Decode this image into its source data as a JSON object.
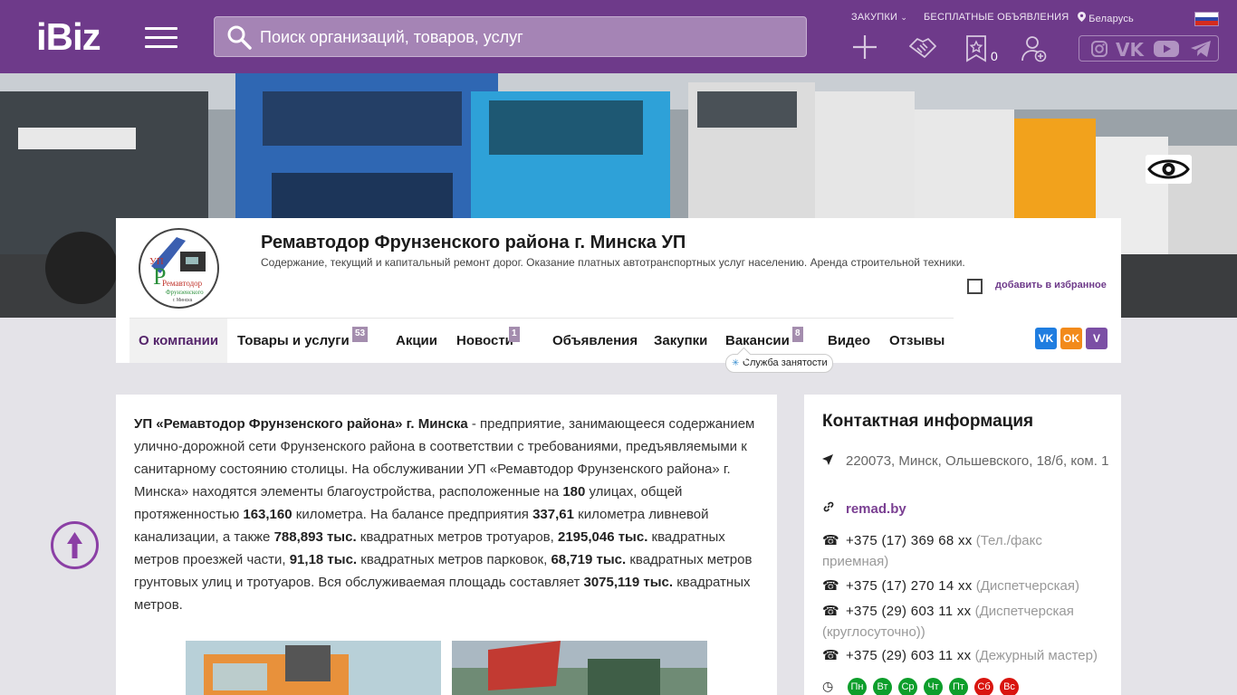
{
  "header": {
    "logo": "iBiz",
    "search_placeholder": "Поиск организаций, товаров, услуг",
    "links": {
      "purchases": "ЗАКУПКИ",
      "free_ads": "БЕСПЛАТНЫЕ ОБЪЯВЛЕНИЯ",
      "region": "Беларусь"
    },
    "favorites_count": "0",
    "icons": [
      "plus-icon",
      "handshake-icon",
      "star-bookmark-icon",
      "add-user-icon"
    ],
    "social": [
      "instagram-icon",
      "vk-icon",
      "youtube-icon",
      "telegram-icon"
    ]
  },
  "company": {
    "title": "Ремавтодор Фрунзенского района г. Минска УП",
    "description": "Содержание, текущий и капитальный ремонт дорог. Оказание платных автотранспортных услуг населению. Аренда строительной техники.",
    "logo_text": [
      "УП",
      "Р",
      "Ремавтодор",
      "Фрунзенского",
      "г. Минска"
    ],
    "favorite_label": "добавить в избранное"
  },
  "tabs": [
    {
      "label": "О компании"
    },
    {
      "label": "Товары и услуги",
      "badge": "53"
    },
    {
      "label": "Акции"
    },
    {
      "label": "Новости",
      "badge": "1"
    },
    {
      "label": "Объявления"
    },
    {
      "label": "Закупки"
    },
    {
      "label": "Вакансии",
      "badge": "8"
    },
    {
      "label": "Видео"
    },
    {
      "label": "Отзывы"
    }
  ],
  "tooltip": "Служба занятости",
  "share": {
    "vk": "VK",
    "ok": "OK",
    "viber": "V"
  },
  "about": {
    "parts": [
      [
        "b",
        "УП «Ремавтодор Фрунзенского района» г. Минска"
      ],
      [
        "t",
        " - предприятие, занимающееся содержанием улично-дорожной сети Фрунзенского района в соответствии с требованиями, предъявляемыми к санитарному состоянию столицы. На обслуживании УП «Ремавтодор Фрунзенского района» г. Минска» находятся элементы благоустройства, расположенные на "
      ],
      [
        "b",
        "180"
      ],
      [
        "t",
        " улицах, общей протяженностью "
      ],
      [
        "b",
        "163,160"
      ],
      [
        "t",
        " километра. На балансе предприятия "
      ],
      [
        "b",
        "337,61"
      ],
      [
        "t",
        " километра ливневой канализации, а также "
      ],
      [
        "b",
        "788,893 тыс."
      ],
      [
        "t",
        " квадратных метров тротуаров, "
      ],
      [
        "b",
        "2195,046 тыс."
      ],
      [
        "t",
        " квадратных метров проезжей части, "
      ],
      [
        "b",
        "91,18 тыс."
      ],
      [
        "t",
        " квадратных метров парковок, "
      ],
      [
        "b",
        "68,719 тыс."
      ],
      [
        "t",
        " квадратных метров грунтовых улиц и тротуаров. Вся обслуживаемая площадь составляет "
      ],
      [
        "b",
        "3075,119 тыс."
      ],
      [
        "t",
        " квадратных метров."
      ]
    ]
  },
  "contacts": {
    "title": "Контактная информация",
    "address": "220073, Минск, Ольшевского, 18/б, ком. 1",
    "site": "remad.by",
    "phones": [
      {
        "number": "+375 (17) 369 68 xx",
        "note": "(Тел./факс приемная)"
      },
      {
        "number": "+375 (17) 270 14 xx",
        "note": "(Диспетчерская)"
      },
      {
        "number": "+375 (29) 603 11 xx",
        "note": "(Диспетчерская (круглосуточно))"
      },
      {
        "number": "+375 (29) 603 11 xx",
        "note": "(Дежурный мастер)"
      }
    ],
    "days": [
      {
        "label": "Пн",
        "color": "#0d9e2b"
      },
      {
        "label": "Вт",
        "color": "#0d9e2b"
      },
      {
        "label": "Ср",
        "color": "#0d9e2b"
      },
      {
        "label": "Чт",
        "color": "#0d9e2b"
      },
      {
        "label": "Пт",
        "color": "#0d9e2b"
      },
      {
        "label": "Сб",
        "color": "#d9150f"
      },
      {
        "label": "Вс",
        "color": "#d9150f"
      }
    ]
  },
  "colors": {
    "brand": "#6e3a8a",
    "accent": "#7a3f92",
    "badge": "#a48dae"
  }
}
